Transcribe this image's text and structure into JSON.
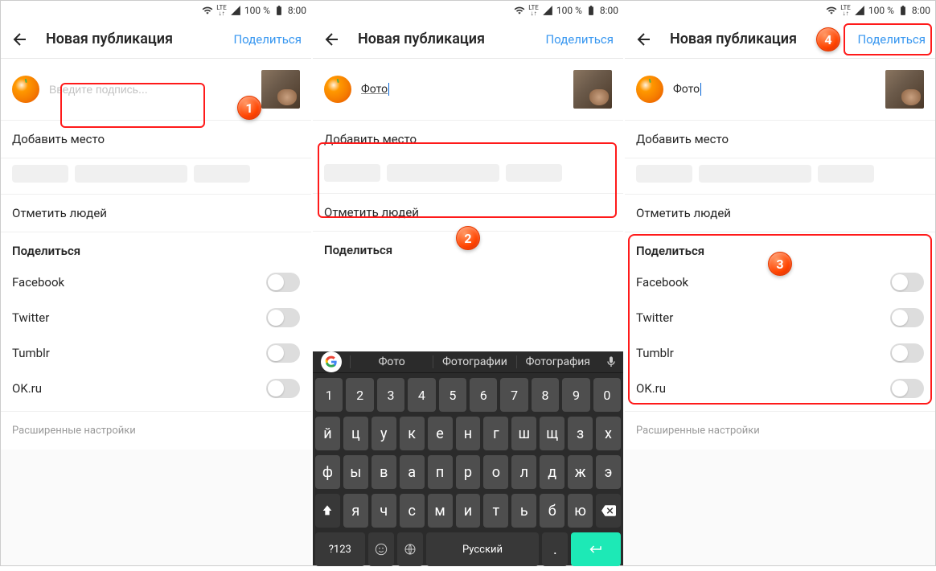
{
  "status": {
    "battery": "100 %",
    "time": "8:00",
    "lte": "LTE"
  },
  "header": {
    "title": "Новая публикация",
    "share": "Поделиться"
  },
  "caption": {
    "placeholder": "Введите подпись...",
    "typed": "Фото"
  },
  "rows": {
    "add_location": "Добавить место",
    "tag_people": "Отметить людей"
  },
  "share": {
    "title": "Поделиться",
    "options": [
      "Facebook",
      "Twitter",
      "Tumblr",
      "OK.ru"
    ]
  },
  "advanced": "Расширенные настройки",
  "badges": {
    "b1": "1",
    "b2": "2",
    "b3": "3",
    "b4": "4"
  },
  "keyboard": {
    "suggestions": [
      "Фото",
      "Фотографии",
      "Фотография"
    ],
    "row_num": [
      "1",
      "2",
      "3",
      "4",
      "5",
      "6",
      "7",
      "8",
      "9",
      "0"
    ],
    "row1": [
      "й",
      "ц",
      "у",
      "к",
      "е",
      "н",
      "г",
      "ш",
      "щ",
      "з",
      "х"
    ],
    "row2": [
      "ф",
      "ы",
      "в",
      "а",
      "п",
      "р",
      "о",
      "л",
      "д",
      "ж",
      "э"
    ],
    "row3": [
      "я",
      "ч",
      "с",
      "м",
      "и",
      "т",
      "ь",
      "б",
      "ю"
    ],
    "sym": "?123",
    "lang": "Русский"
  }
}
